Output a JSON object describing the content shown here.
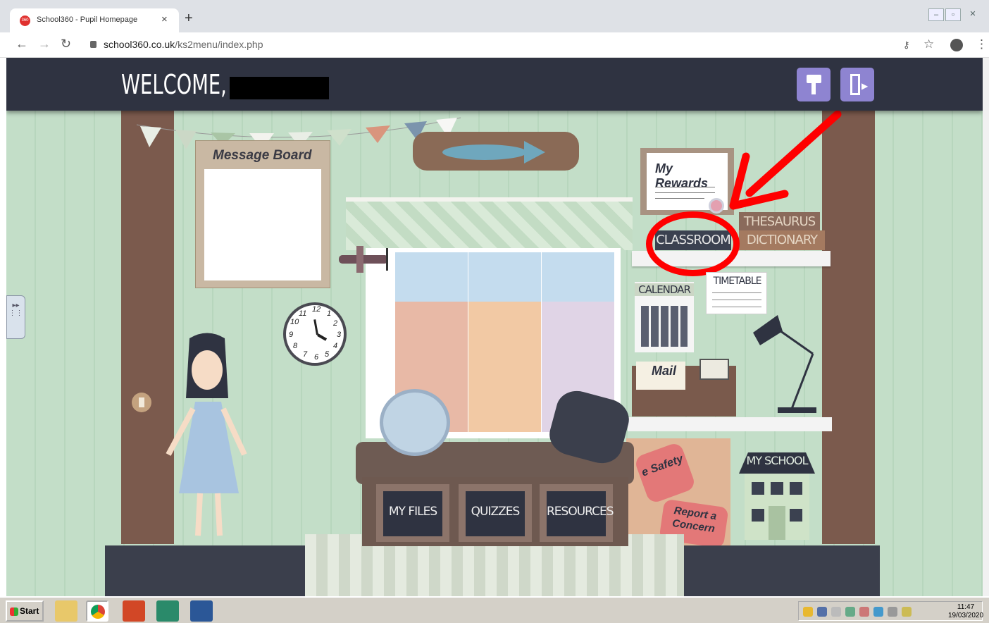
{
  "browser": {
    "tab_title": "School360 - Pupil Homepage",
    "tab_close": "×",
    "new_tab": "+",
    "url_host": "school360.co.uk",
    "url_path": "/ks2menu/index.php"
  },
  "header": {
    "welcome": "WELCOME,"
  },
  "scene": {
    "message_board": "Message Board",
    "my_rewards": "My Rewards",
    "classroom": "CLASSROOM",
    "thesaurus": "THESAURUS",
    "dictionary": "DICTIONARY",
    "calendar": "CALENDAR",
    "timetable": "TIMETABLE",
    "mail": "Mail",
    "my_school": "MY SCHOOL",
    "esafety": "e Safety",
    "report_concern": "Report a Concern",
    "my_files": "MY FILES",
    "quizzes": "QUIZZES",
    "resources": "RESOURCES",
    "clock_numbers": [
      "12",
      "1",
      "2",
      "3",
      "4",
      "5",
      "6",
      "7",
      "8",
      "9",
      "10",
      "11"
    ]
  },
  "annotation": {
    "arrow_color": "#ff0000",
    "circle_color": "#ff0000"
  },
  "taskbar": {
    "start": "Start",
    "time": "11:47",
    "date": "19/03/2020"
  },
  "colors": {
    "header_bg": "#2f3341",
    "header_button": "#8e84d1",
    "wall": "#bfdcc4"
  }
}
